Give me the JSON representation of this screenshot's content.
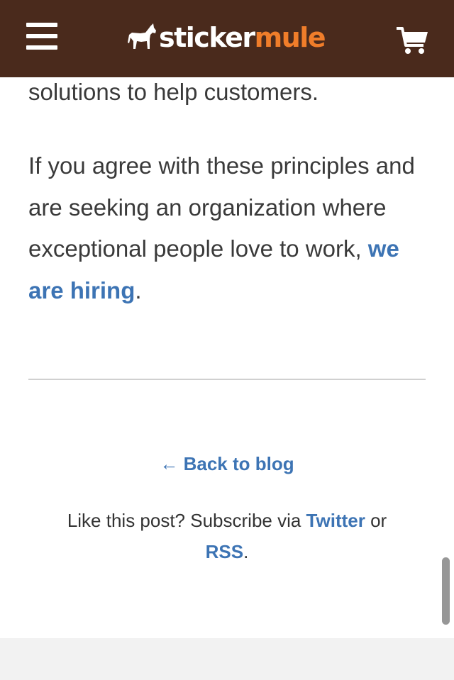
{
  "header": {
    "logo_left": "sticker",
    "logo_right": "mule",
    "background_color": "#4a2a1c",
    "accent_color": "#f07d2a",
    "menu_icon": "hamburger-menu-icon",
    "cart_icon": "shopping-cart-icon",
    "logo_icon": "mule-logo-icon"
  },
  "article": {
    "partial_line": "solutions to help customers.",
    "paragraph_text": "If you agree with these principles and are seeking an organization where exceptional people love to work, ",
    "hiring_link": "we are hiring",
    "paragraph_end": "."
  },
  "footer_nav": {
    "back_to_blog": "← Back to blog",
    "subscribe_prefix": "Like this post? Subscribe via ",
    "twitter_link": "Twitter",
    "subscribe_or": " or",
    "rss_link": "RSS",
    "subscribe_end": ".",
    "link_color": "#3d74b4"
  }
}
